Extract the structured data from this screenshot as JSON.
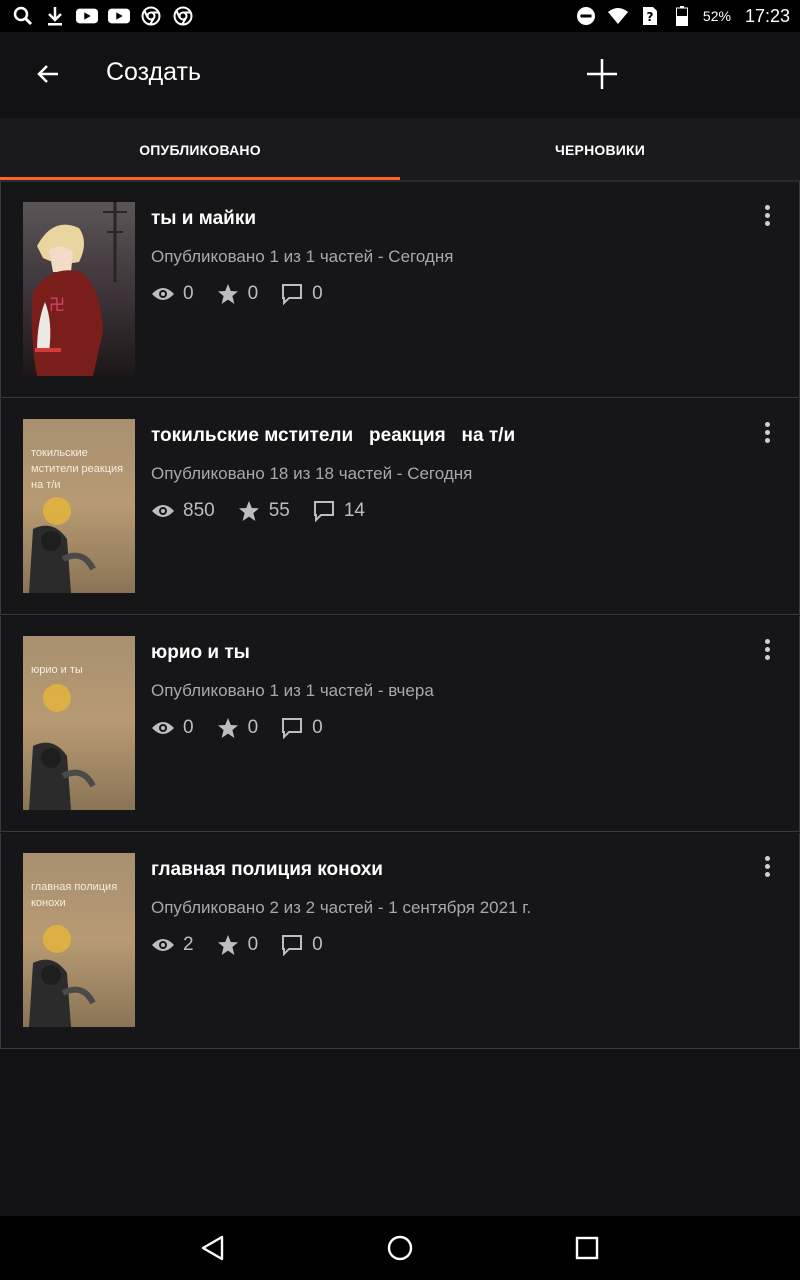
{
  "status_bar": {
    "left_icons": [
      "search-icon",
      "download-icon",
      "youtube-icon",
      "youtube-icon",
      "chrome-icon",
      "chrome-icon"
    ],
    "battery": "52%",
    "time": "17:23"
  },
  "app_bar": {
    "title": "Создать"
  },
  "tabs": [
    {
      "label": "ОПУБЛИКОВАНО",
      "active": true
    },
    {
      "label": "ЧЕРНОВИКИ",
      "active": false
    }
  ],
  "stories": [
    {
      "title": "ты и майки",
      "meta": "Опубликовано 1 из 1 частей - Сегодня",
      "views": "0",
      "votes": "0",
      "comments": "0",
      "cover_text": ""
    },
    {
      "title": "токильские мстители   реакция   на т/и",
      "meta": "Опубликовано 18 из 18 частей - Сегодня",
      "views": "850",
      "votes": "55",
      "comments": "14",
      "cover_text": "токильские мстители реакция на т/и"
    },
    {
      "title": "юрио и ты",
      "meta": "Опубликовано 1 из 1 частей - вчера",
      "views": "0",
      "votes": "0",
      "comments": "0",
      "cover_text": "юрио и ты"
    },
    {
      "title": "главная полиция конохи",
      "meta": "Опубликовано 2 из 2 частей - 1 сентября 2021 г.",
      "views": "2",
      "votes": "0",
      "comments": "0",
      "cover_text": "главная полиция конохи"
    }
  ],
  "colors": {
    "accent": "#ff6122",
    "background": "#121113",
    "card": "#161518"
  }
}
